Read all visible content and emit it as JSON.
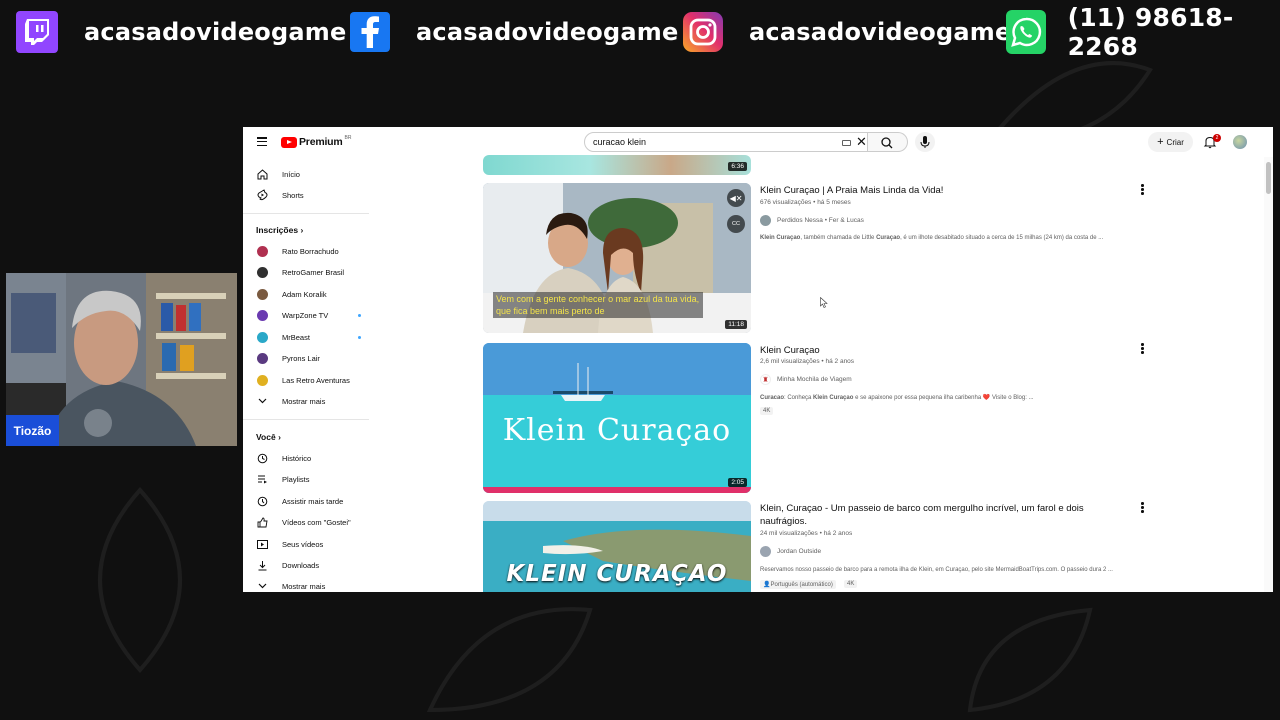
{
  "overlay": {
    "social": [
      {
        "icon": "twitch-icon",
        "handle": "acasadovideogame",
        "color": "#9146ff"
      },
      {
        "icon": "facebook-icon",
        "handle": "acasadovideogame",
        "color": "#1877f2"
      },
      {
        "icon": "instagram-icon",
        "handle": "acasadovideogame",
        "color": "#e1306c"
      },
      {
        "icon": "whatsapp-icon",
        "handle": "(11) 98618-2268",
        "color": "#25d366"
      }
    ],
    "webcam_name": "Tiozão"
  },
  "youtube": {
    "logo_text": "Premium",
    "logo_region": "BR",
    "search": {
      "value": "curacao klein"
    },
    "create_label": "Criar",
    "notifications_count": "2",
    "sidebar": {
      "main": [
        {
          "label": "Início",
          "icon": "home-icon"
        },
        {
          "label": "Shorts",
          "icon": "shorts-icon"
        }
      ],
      "subscriptions_title": "Inscrições",
      "subscriptions": [
        {
          "label": "Rato Borrachudo",
          "live": false,
          "color": "#b03050"
        },
        {
          "label": "RetroGamer Brasil",
          "live": false,
          "color": "#303030"
        },
        {
          "label": "Adam Koralik",
          "live": false,
          "color": "#7a5a40"
        },
        {
          "label": "WarpZone TV",
          "live": true,
          "color": "#6a3ab0"
        },
        {
          "label": "MrBeast",
          "live": true,
          "color": "#2aa8c8"
        },
        {
          "label": "Pyrons Lair",
          "live": false,
          "color": "#5a3a80"
        },
        {
          "label": "Las Retro Aventuras",
          "live": false,
          "color": "#e0b020"
        }
      ],
      "subs_more": "Mostrar mais",
      "you_title": "Você",
      "you": [
        {
          "label": "Histórico",
          "icon": "history-icon"
        },
        {
          "label": "Playlists",
          "icon": "playlist-icon"
        },
        {
          "label": "Assistir mais tarde",
          "icon": "clock-icon"
        },
        {
          "label": "Vídeos com \"Gostei\"",
          "icon": "like-icon"
        },
        {
          "label": "Seus vídeos",
          "icon": "video-icon"
        },
        {
          "label": "Downloads",
          "icon": "download-icon"
        }
      ],
      "you_more": "Mostrar mais"
    },
    "results": [
      {
        "duration": "6:36"
      },
      {
        "title": "Klein Curaçao | A Praia Mais Linda da Vida!",
        "meta": "676 visualizações • há 5 meses",
        "channel": "Perdidos Nessa • Fer & Lucas",
        "desc_strong": "Klein Curaçao",
        "desc": ", também chamada de Little ",
        "desc_strong2": "Curaçao",
        "desc_tail": ", é um ilhote desabitado situado a cerca de 15 milhas (24 km) da costa de ...",
        "duration": "11:18",
        "caption": "Vem com a gente conhecer o mar azul da tua vida, que fica bem mais perto de"
      },
      {
        "title": "Klein Curaçao",
        "meta": "2,6 mil visualizações • há 2 anos",
        "channel": "Minha Mochila de Viagem",
        "desc_strong": "Curacao",
        "desc": ": Conheça ",
        "desc_strong2": "Klein Curaçao",
        "desc_tail": " e se apaixone por essa pequena ilha caribenha ❤️ Visite o Blog: ...",
        "tag": "4K",
        "duration": "2:05",
        "thumb_text": "Klein Curaçao"
      },
      {
        "title": "Klein, Curaçao - Um passeio de barco com mergulho incrível, um farol e dois naufrágios.",
        "meta": "24 mil visualizações • há 2 anos",
        "channel": "Jordan Outside",
        "desc_tail": "Reservamos nosso passeio de barco para a remota ilha de Klein, em Curaçao, pelo site MermaidBoatTrips.com. O passeio dura 2 ...",
        "tag1": "Português (automático)",
        "tag2": "4K",
        "thumb_text": "KLEIN CURAÇAO"
      }
    ]
  }
}
